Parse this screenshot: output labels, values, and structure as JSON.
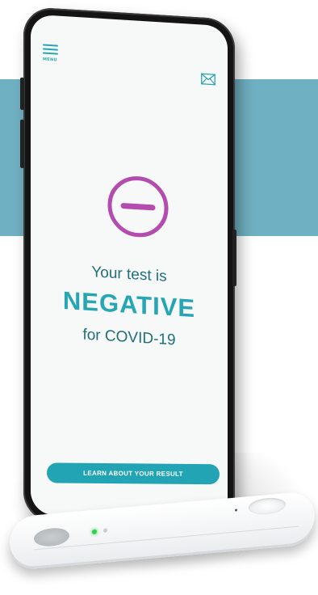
{
  "colors": {
    "background_band": "#6fb0c2",
    "accent": "#26a6b5",
    "text_dark_teal": "#1f6e7a",
    "negative_symbol": "#b34cae",
    "led": "#2fd14f"
  },
  "app": {
    "menu": {
      "label": "MENU",
      "icon": "hamburger-menu-icon"
    },
    "mail": {
      "icon": "envelope-icon"
    },
    "result": {
      "icon": "minus-circle-icon",
      "line1": "Your test is",
      "status": "NEGATIVE",
      "line3": "for COVID-19"
    },
    "cta": {
      "label": "LEARN ABOUT YOUR RESULT"
    }
  }
}
